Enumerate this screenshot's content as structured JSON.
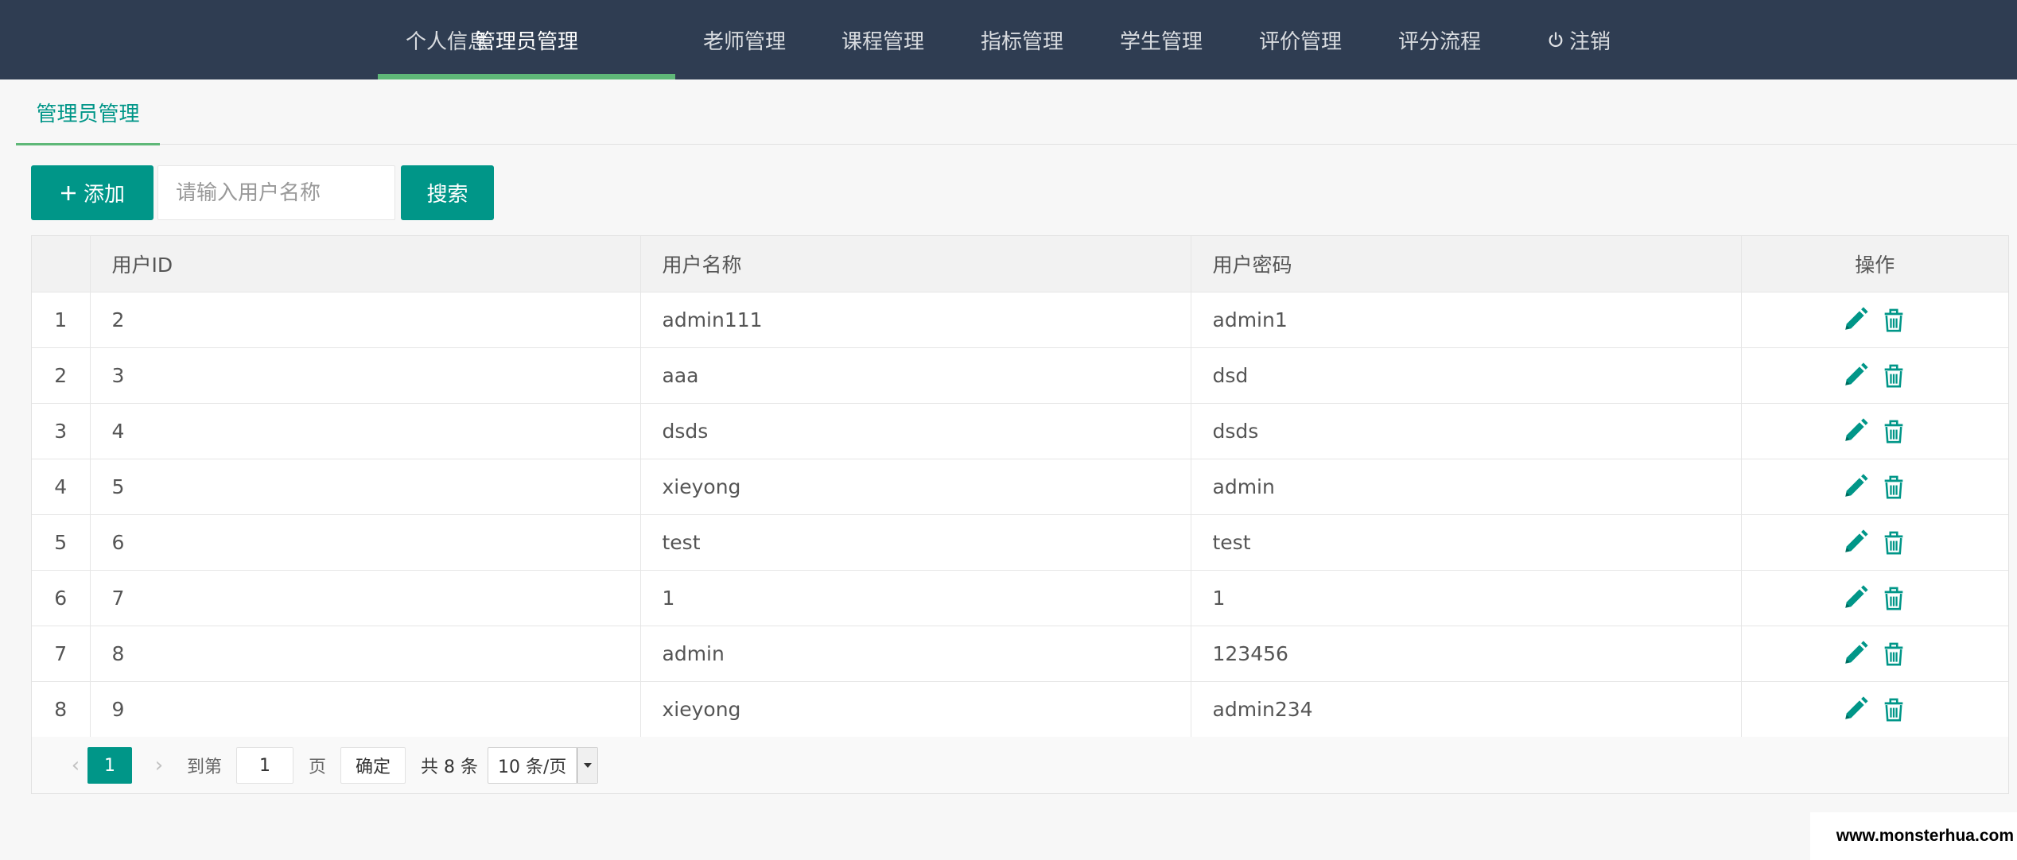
{
  "nav": {
    "items": [
      {
        "label": "个人信息"
      },
      {
        "label": "管理员管理"
      },
      {
        "label": "老师管理"
      },
      {
        "label": "课程管理"
      },
      {
        "label": "指标管理"
      },
      {
        "label": "学生管理"
      },
      {
        "label": "评价管理"
      },
      {
        "label": "评分流程"
      },
      {
        "label": "注销"
      }
    ],
    "active_index": 1,
    "colors": {
      "bg": "#2f3d52",
      "active_underline": "#5fb878"
    }
  },
  "tab": {
    "label": "管理员管理"
  },
  "toolbar": {
    "add_label": "添加",
    "search_placeholder": "请输入用户名称",
    "search_value": "",
    "search_label": "搜索"
  },
  "table": {
    "headers": [
      "",
      "用户ID",
      "用户名称",
      "用户密码",
      "操作"
    ],
    "rows": [
      {
        "no": "1",
        "id": "2",
        "name": "admin111",
        "password": "admin1"
      },
      {
        "no": "2",
        "id": "3",
        "name": "aaa",
        "password": "dsd"
      },
      {
        "no": "3",
        "id": "4",
        "name": "dsds",
        "password": "dsds"
      },
      {
        "no": "4",
        "id": "5",
        "name": "xieyong",
        "password": "admin"
      },
      {
        "no": "5",
        "id": "6",
        "name": "test",
        "password": "test"
      },
      {
        "no": "6",
        "id": "7",
        "name": "1",
        "password": "1"
      },
      {
        "no": "7",
        "id": "8",
        "name": "admin",
        "password": "123456"
      },
      {
        "no": "8",
        "id": "9",
        "name": "xieyong",
        "password": "admin234"
      }
    ],
    "row_actions": [
      "edit-icon",
      "trash-icon"
    ]
  },
  "pager": {
    "current_page": "1",
    "goto_prefix": "到第",
    "goto_value": "1",
    "goto_suffix": "页",
    "confirm_label": "确定",
    "total_label": "共 8 条",
    "page_size_label": "10 条/页"
  },
  "watermark": "www.monsterhua.com",
  "accent_color": "#009688"
}
